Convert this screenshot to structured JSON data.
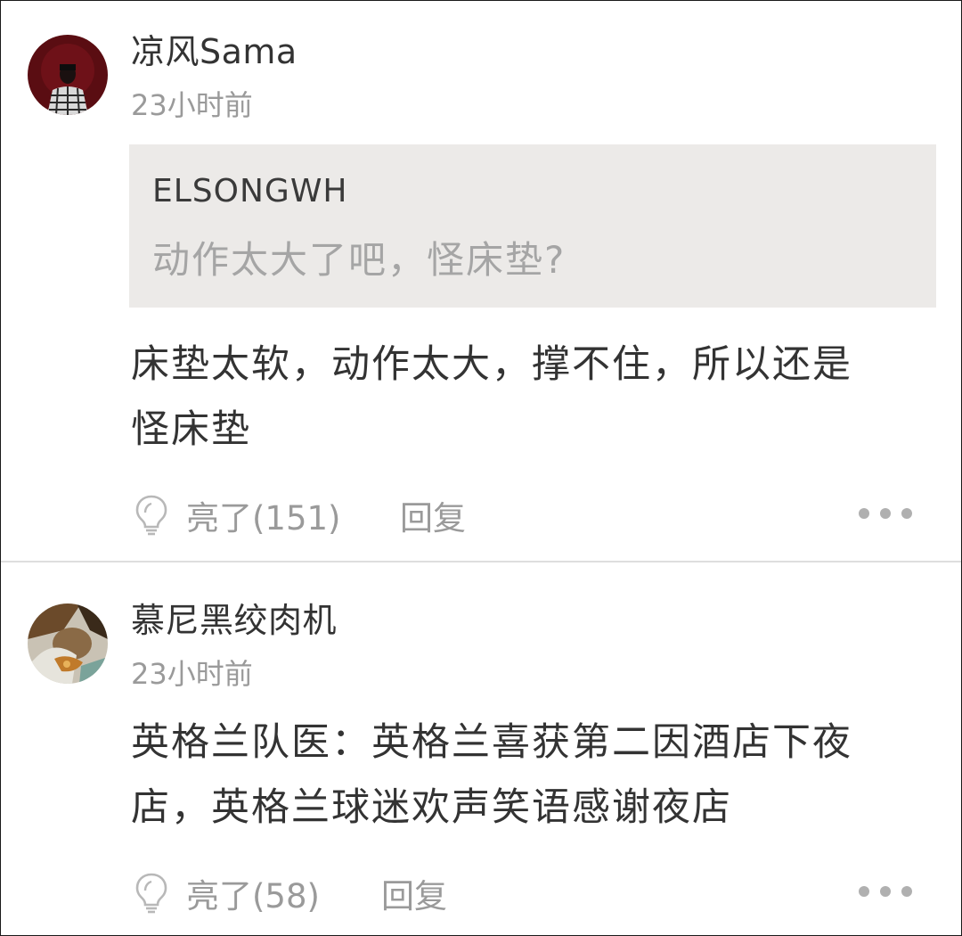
{
  "comments": [
    {
      "username": "凉风Sama",
      "time": "23小时前",
      "quote": {
        "user": "ELSONGWH",
        "text": "动作太大了吧，怪床垫?"
      },
      "lines": [
        "床垫太软，动作太大，撑不住，所以还是",
        "怪床垫"
      ],
      "like_label": "亮了(151)",
      "reply_label": "回复",
      "avatar_icon": "user-avatar",
      "like_icon": "lightbulb-icon",
      "more_icon": "more-dots-icon"
    },
    {
      "username": "慕尼黑绞肉机",
      "time": "23小时前",
      "lines": [
        "英格兰队医：英格兰喜获第二因酒店下夜",
        "店，英格兰球迷欢声笑语感谢夜店"
      ],
      "like_label": "亮了(58)",
      "reply_label": "回复",
      "avatar_icon": "user-avatar",
      "like_icon": "lightbulb-icon",
      "more_icon": "more-dots-icon"
    }
  ],
  "colors": {
    "text_primary": "#333333",
    "text_secondary": "#9a9a9a",
    "quote_bg": "#eceae8",
    "quote_text": "#a5a5a5",
    "separator": "#dedede"
  }
}
